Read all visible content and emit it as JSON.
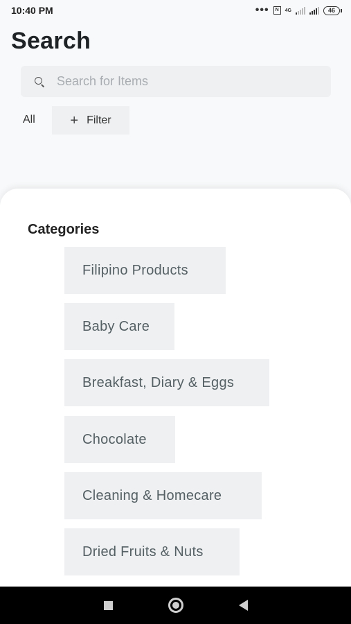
{
  "status_bar": {
    "time": "10:40 PM",
    "dots": "•••",
    "box_label": "N",
    "network_label": "4G",
    "battery": "46"
  },
  "page": {
    "title": "Search"
  },
  "search": {
    "placeholder": "Search for Items",
    "value": ""
  },
  "filters": {
    "all_label": "All",
    "filter_label": "Filter",
    "plus_glyph": "+"
  },
  "categories": {
    "title": "Categories",
    "items": [
      {
        "label": "Filipino Products"
      },
      {
        "label": "Baby Care"
      },
      {
        "label": "Breakfast, Diary & Eggs"
      },
      {
        "label": "Chocolate"
      },
      {
        "label": "Cleaning & Homecare"
      },
      {
        "label": "Dried Fruits & Nuts"
      }
    ]
  },
  "nav": {
    "icons": [
      "recents-icon",
      "home-icon",
      "back-icon"
    ]
  }
}
